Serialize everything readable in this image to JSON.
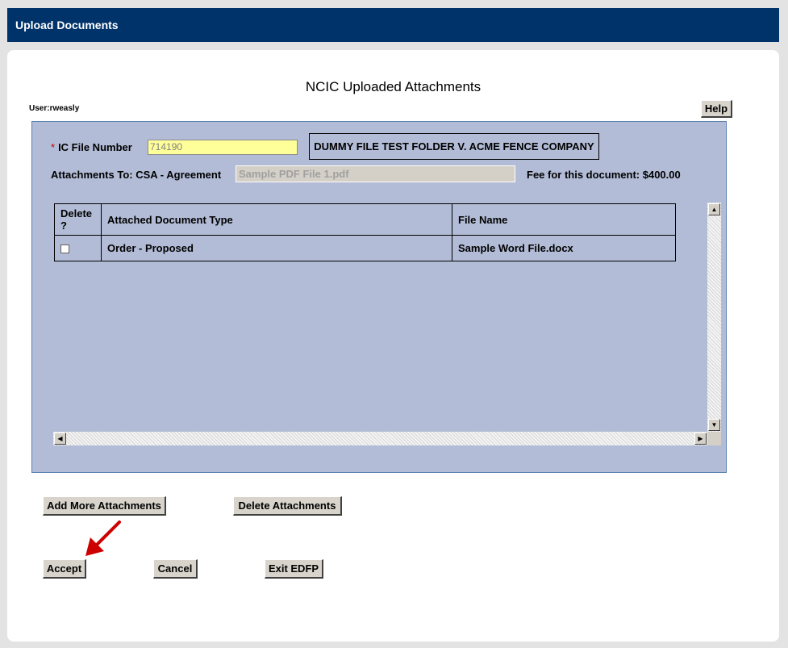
{
  "window": {
    "title": "Upload Documents"
  },
  "page": {
    "heading": "NCIC Uploaded Attachments",
    "user_label": "User:rweasly",
    "help_label": "Help"
  },
  "form": {
    "required_marker": "*",
    "ic_file_label": "IC File Number",
    "ic_file_value": "714190",
    "folder_name": "DUMMY FILE TEST FOLDER V. ACME FENCE COMPANY",
    "attachments_label": "Attachments To: CSA - Agreement",
    "attachment_file_value": "Sample PDF File 1.pdf",
    "fee_label": "Fee for this document: $400.00"
  },
  "table": {
    "headers": [
      "Delete ?",
      "Attached Document Type",
      "File Name"
    ],
    "rows": [
      {
        "delete_checked": false,
        "doc_type": "Order - Proposed",
        "file_name": "Sample Word File.docx"
      }
    ]
  },
  "actions": {
    "add_more": "Add More Attachments",
    "delete": "Delete Attachments",
    "accept": "Accept",
    "cancel": "Cancel",
    "exit": "Exit EDFP"
  },
  "icons": {
    "scroll_up": "scroll-up-arrow-icon",
    "scroll_down": "scroll-down-arrow-icon",
    "scroll_left": "scroll-left-arrow-icon",
    "scroll_right": "scroll-right-arrow-icon",
    "annotation_arrow": "red-pointer-arrow-icon"
  },
  "colors": {
    "titlebar": "#00336a",
    "panel": "#b2bcd6",
    "required": "#c00000",
    "highlight_input": "#ffff99",
    "annotation_arrow": "#cc0000"
  }
}
